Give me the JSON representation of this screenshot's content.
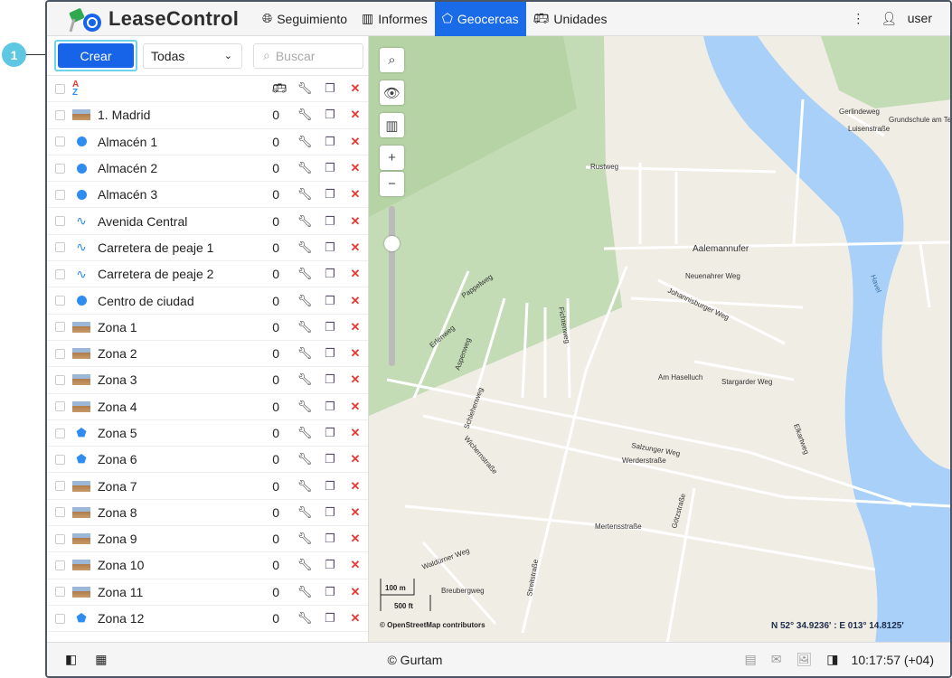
{
  "callout": "1",
  "header": {
    "brand": "LeaseControl",
    "nav": [
      {
        "label": "Seguimiento",
        "icon": "globe-icon"
      },
      {
        "label": "Informes",
        "icon": "report-icon"
      },
      {
        "label": "Geocercas",
        "icon": "geofence-icon",
        "active": true
      },
      {
        "label": "Unidades",
        "icon": "bus-icon"
      }
    ],
    "user": "user"
  },
  "toolbar": {
    "create": "Crear",
    "filter": "Todas",
    "search_placeholder": "Buscar"
  },
  "list": [
    {
      "name": "1. Madrid",
      "type": "image",
      "count": "0"
    },
    {
      "name": "Almacén 1",
      "type": "circle",
      "count": "0"
    },
    {
      "name": "Almacén 2",
      "type": "circle",
      "count": "0"
    },
    {
      "name": "Almacén 3",
      "type": "circle",
      "count": "0"
    },
    {
      "name": "Avenida Central",
      "type": "line",
      "count": "0"
    },
    {
      "name": "Carretera de peaje 1",
      "type": "line",
      "count": "0"
    },
    {
      "name": "Carretera de peaje 2",
      "type": "line",
      "count": "0"
    },
    {
      "name": "Centro de ciudad",
      "type": "circle",
      "count": "0"
    },
    {
      "name": "Zona 1",
      "type": "image",
      "count": "0"
    },
    {
      "name": "Zona 2",
      "type": "image",
      "count": "0"
    },
    {
      "name": "Zona 3",
      "type": "image",
      "count": "0"
    },
    {
      "name": "Zona 4",
      "type": "image",
      "count": "0"
    },
    {
      "name": "Zona 5",
      "type": "polygon",
      "count": "0"
    },
    {
      "name": "Zona 6",
      "type": "polygon",
      "count": "0"
    },
    {
      "name": "Zona 7",
      "type": "image",
      "count": "0"
    },
    {
      "name": "Zona 8",
      "type": "image",
      "count": "0"
    },
    {
      "name": "Zona 9",
      "type": "image",
      "count": "0"
    },
    {
      "name": "Zona 10",
      "type": "image",
      "count": "0"
    },
    {
      "name": "Zona 11",
      "type": "image",
      "count": "0"
    },
    {
      "name": "Zona 12",
      "type": "polygon",
      "count": "0"
    }
  ],
  "map": {
    "scale_metric": "100 m",
    "scale_imperial": "500 ft",
    "attribution": "© OpenStreetMap contributors",
    "coords": "N 52° 34.9236' : E 013° 14.8125'",
    "labels": [
      "Rustweg",
      "Aalemannufer",
      "Neuenahrer Weg",
      "Johannisburger Weg",
      "Werderstraße",
      "Mertensstraße",
      "Salzunger Weg",
      "Stargarder Weg",
      "Am Haselluch",
      "Waldürner Weg",
      "Breubergweg",
      "Streitstraße",
      "Havel",
      "Gerlindeweg",
      "Grundschule am Tegelschen Ort",
      "Luisenstraße",
      "Erlenweg",
      "Aspenweg",
      "Pappelweg",
      "Fichtenweg",
      "Elkartweg",
      "Götzstraße",
      "Schlehenweg",
      "Wichernstraße"
    ]
  },
  "footer": {
    "copyright": "© Gurtam",
    "time": "10:17:57 (+04)"
  }
}
